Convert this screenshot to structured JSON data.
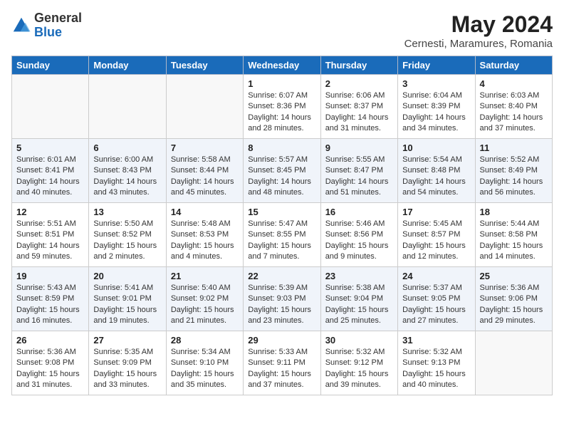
{
  "logo": {
    "general": "General",
    "blue": "Blue"
  },
  "title": "May 2024",
  "location": "Cernesti, Maramures, Romania",
  "weekdays": [
    "Sunday",
    "Monday",
    "Tuesday",
    "Wednesday",
    "Thursday",
    "Friday",
    "Saturday"
  ],
  "weeks": [
    [
      {
        "day": "",
        "info": ""
      },
      {
        "day": "",
        "info": ""
      },
      {
        "day": "",
        "info": ""
      },
      {
        "day": "1",
        "info": "Sunrise: 6:07 AM\nSunset: 8:36 PM\nDaylight: 14 hours\nand 28 minutes."
      },
      {
        "day": "2",
        "info": "Sunrise: 6:06 AM\nSunset: 8:37 PM\nDaylight: 14 hours\nand 31 minutes."
      },
      {
        "day": "3",
        "info": "Sunrise: 6:04 AM\nSunset: 8:39 PM\nDaylight: 14 hours\nand 34 minutes."
      },
      {
        "day": "4",
        "info": "Sunrise: 6:03 AM\nSunset: 8:40 PM\nDaylight: 14 hours\nand 37 minutes."
      }
    ],
    [
      {
        "day": "5",
        "info": "Sunrise: 6:01 AM\nSunset: 8:41 PM\nDaylight: 14 hours\nand 40 minutes."
      },
      {
        "day": "6",
        "info": "Sunrise: 6:00 AM\nSunset: 8:43 PM\nDaylight: 14 hours\nand 43 minutes."
      },
      {
        "day": "7",
        "info": "Sunrise: 5:58 AM\nSunset: 8:44 PM\nDaylight: 14 hours\nand 45 minutes."
      },
      {
        "day": "8",
        "info": "Sunrise: 5:57 AM\nSunset: 8:45 PM\nDaylight: 14 hours\nand 48 minutes."
      },
      {
        "day": "9",
        "info": "Sunrise: 5:55 AM\nSunset: 8:47 PM\nDaylight: 14 hours\nand 51 minutes."
      },
      {
        "day": "10",
        "info": "Sunrise: 5:54 AM\nSunset: 8:48 PM\nDaylight: 14 hours\nand 54 minutes."
      },
      {
        "day": "11",
        "info": "Sunrise: 5:52 AM\nSunset: 8:49 PM\nDaylight: 14 hours\nand 56 minutes."
      }
    ],
    [
      {
        "day": "12",
        "info": "Sunrise: 5:51 AM\nSunset: 8:51 PM\nDaylight: 14 hours\nand 59 minutes."
      },
      {
        "day": "13",
        "info": "Sunrise: 5:50 AM\nSunset: 8:52 PM\nDaylight: 15 hours\nand 2 minutes."
      },
      {
        "day": "14",
        "info": "Sunrise: 5:48 AM\nSunset: 8:53 PM\nDaylight: 15 hours\nand 4 minutes."
      },
      {
        "day": "15",
        "info": "Sunrise: 5:47 AM\nSunset: 8:55 PM\nDaylight: 15 hours\nand 7 minutes."
      },
      {
        "day": "16",
        "info": "Sunrise: 5:46 AM\nSunset: 8:56 PM\nDaylight: 15 hours\nand 9 minutes."
      },
      {
        "day": "17",
        "info": "Sunrise: 5:45 AM\nSunset: 8:57 PM\nDaylight: 15 hours\nand 12 minutes."
      },
      {
        "day": "18",
        "info": "Sunrise: 5:44 AM\nSunset: 8:58 PM\nDaylight: 15 hours\nand 14 minutes."
      }
    ],
    [
      {
        "day": "19",
        "info": "Sunrise: 5:43 AM\nSunset: 8:59 PM\nDaylight: 15 hours\nand 16 minutes."
      },
      {
        "day": "20",
        "info": "Sunrise: 5:41 AM\nSunset: 9:01 PM\nDaylight: 15 hours\nand 19 minutes."
      },
      {
        "day": "21",
        "info": "Sunrise: 5:40 AM\nSunset: 9:02 PM\nDaylight: 15 hours\nand 21 minutes."
      },
      {
        "day": "22",
        "info": "Sunrise: 5:39 AM\nSunset: 9:03 PM\nDaylight: 15 hours\nand 23 minutes."
      },
      {
        "day": "23",
        "info": "Sunrise: 5:38 AM\nSunset: 9:04 PM\nDaylight: 15 hours\nand 25 minutes."
      },
      {
        "day": "24",
        "info": "Sunrise: 5:37 AM\nSunset: 9:05 PM\nDaylight: 15 hours\nand 27 minutes."
      },
      {
        "day": "25",
        "info": "Sunrise: 5:36 AM\nSunset: 9:06 PM\nDaylight: 15 hours\nand 29 minutes."
      }
    ],
    [
      {
        "day": "26",
        "info": "Sunrise: 5:36 AM\nSunset: 9:08 PM\nDaylight: 15 hours\nand 31 minutes."
      },
      {
        "day": "27",
        "info": "Sunrise: 5:35 AM\nSunset: 9:09 PM\nDaylight: 15 hours\nand 33 minutes."
      },
      {
        "day": "28",
        "info": "Sunrise: 5:34 AM\nSunset: 9:10 PM\nDaylight: 15 hours\nand 35 minutes."
      },
      {
        "day": "29",
        "info": "Sunrise: 5:33 AM\nSunset: 9:11 PM\nDaylight: 15 hours\nand 37 minutes."
      },
      {
        "day": "30",
        "info": "Sunrise: 5:32 AM\nSunset: 9:12 PM\nDaylight: 15 hours\nand 39 minutes."
      },
      {
        "day": "31",
        "info": "Sunrise: 5:32 AM\nSunset: 9:13 PM\nDaylight: 15 hours\nand 40 minutes."
      },
      {
        "day": "",
        "info": ""
      }
    ]
  ]
}
